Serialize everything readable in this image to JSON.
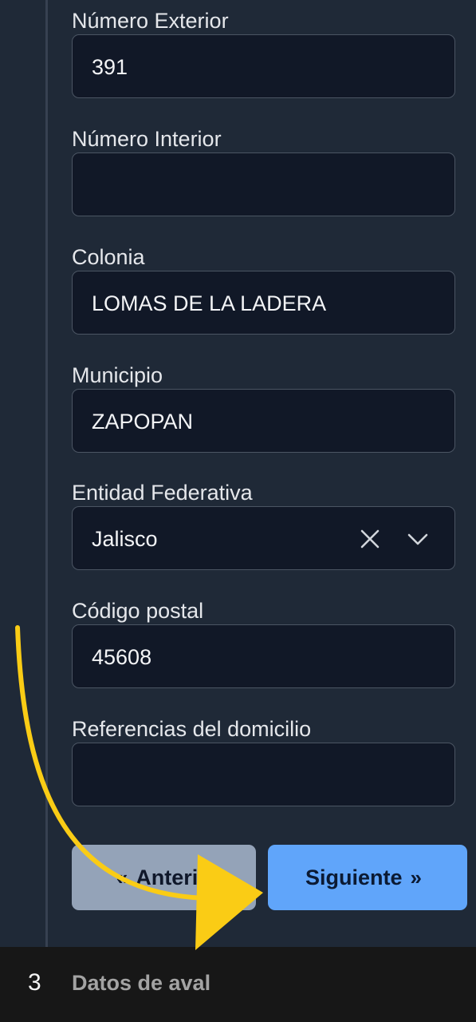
{
  "form": {
    "fields": [
      {
        "label": "Número Exterior",
        "value": ""
      },
      {
        "label": "Número Exterior",
        "value": "391"
      },
      {
        "label": "Número Interior",
        "value": ""
      },
      {
        "label": "Colonia",
        "value": "LOMAS DE LA LADERA"
      },
      {
        "label": "Municipio",
        "value": "ZAPOPAN"
      },
      {
        "label": "Entidad Federativa",
        "value": "Jalisco"
      },
      {
        "label": "Código postal",
        "value": "45608"
      },
      {
        "label": "Referencias del domicilio",
        "value": ""
      }
    ]
  },
  "buttons": {
    "prev_label": "Anterior",
    "prev_icon": "double-chevron-left-icon",
    "next_label": "Siguiente",
    "next_icon": "double-chevron-right-icon"
  },
  "footer": {
    "step_number": "3",
    "step_title": "Datos de aval"
  },
  "colors": {
    "accent": "#60a5fa",
    "annotation": "#facc15"
  }
}
